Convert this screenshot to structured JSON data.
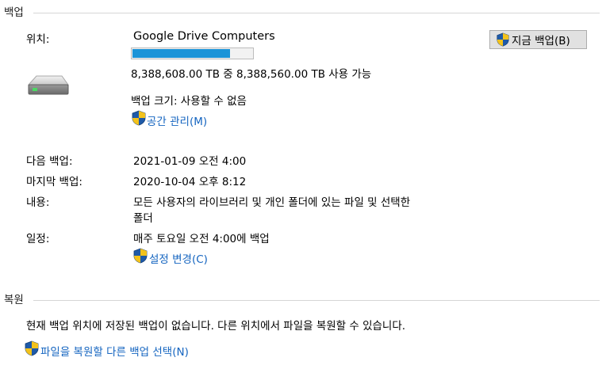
{
  "backup": {
    "section_title": "백업",
    "location_label": "위치:",
    "location_name": "Google Drive Computers",
    "usage_fraction": 0.82,
    "capacity_text": "8,388,608.00 TB 중 8,388,560.00 TB 사용 가능",
    "size_text": "백업 크기: 사용할 수 없음",
    "manage_space_link": "공간 관리(M)",
    "backup_now_button": "지금 백업(B)",
    "next_label": "다음 백업:",
    "next_value": "2021-01-09 오전 4:00",
    "last_label": "마지막 백업:",
    "last_value": "2020-10-04 오후 8:12",
    "contents_label": "내용:",
    "contents_line1": "모든 사용자의 라이브러리 및 개인 폴더에 있는 파일 및 선택한",
    "contents_line2": "폴더",
    "schedule_label": "일정:",
    "schedule_value": "매주 토요일 오전 4:00에 백업",
    "change_settings_link": "설정 변경(C)"
  },
  "restore": {
    "section_title": "복원",
    "message": "현재 백업 위치에 저장된 백업이 없습니다. 다른 위치에서 파일을 복원할 수 있습니다.",
    "select_backup_link": "파일을 복원할 다른 백업 선택(N)"
  },
  "icons": {
    "drive": "drive-icon",
    "shield": "uac-shield-icon"
  },
  "colors": {
    "link": "#1565c0",
    "progress": "#1c94d8"
  }
}
